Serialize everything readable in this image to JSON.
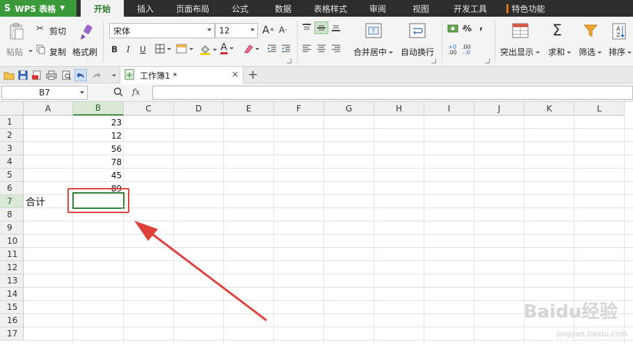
{
  "app": {
    "logo": "S",
    "name": "WPS 表格"
  },
  "menu": {
    "tabs": [
      {
        "label": "开始",
        "active": true
      },
      {
        "label": "插入"
      },
      {
        "label": "页面布局"
      },
      {
        "label": "公式"
      },
      {
        "label": "数据"
      },
      {
        "label": "表格样式"
      },
      {
        "label": "审阅"
      },
      {
        "label": "视图"
      },
      {
        "label": "开发工具"
      },
      {
        "label": "特色功能"
      }
    ]
  },
  "ribbon": {
    "paste": "粘贴",
    "cut": "剪切",
    "copy": "复制",
    "format_painter": "格式刷",
    "font_name": "宋体",
    "font_size": "12",
    "bold": "B",
    "italic": "I",
    "underline": "U",
    "merge_center": "合并居中",
    "wrap_text": "自动换行",
    "percent": "%",
    "comma": ",",
    "conditional_format": "突出显示",
    "sum": "求和",
    "filter": "筛选",
    "sort": "排序"
  },
  "document": {
    "tab_name": "工作簿1 *"
  },
  "formula_bar": {
    "name_box": "B7",
    "fx_label": "fx",
    "value": ""
  },
  "sheet": {
    "columns": [
      "A",
      "B",
      "C",
      "D",
      "E",
      "F",
      "G",
      "H",
      "I",
      "J",
      "K",
      "L"
    ],
    "selected_column": "B",
    "rows": [
      "1",
      "2",
      "3",
      "4",
      "5",
      "6",
      "7",
      "8",
      "9",
      "10",
      "11",
      "12",
      "13",
      "14",
      "15",
      "16",
      "17"
    ],
    "selected_row": "7",
    "b_values": [
      "23",
      "12",
      "56",
      "78",
      "45",
      "89"
    ],
    "a7_label": "合计"
  },
  "watermark": {
    "brand": "Baidu经验",
    "url": "jingyan.baidu.com"
  },
  "colors": {
    "accent": "#3a9a3a",
    "selection": "#2e7d32",
    "annotation": "#e0403a"
  }
}
